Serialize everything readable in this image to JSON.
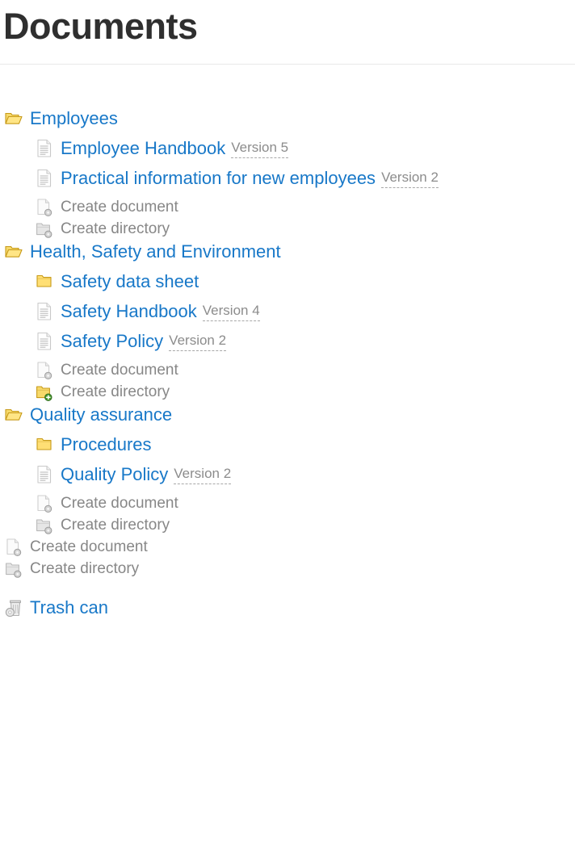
{
  "header": {
    "title": "Documents"
  },
  "colors": {
    "link": "#1878c8",
    "muted_text": "#878787",
    "version_text": "#8c8c8c",
    "heading": "#2f2f2f",
    "rule": "#e8e8e8",
    "folder_fill": "#ffe07a",
    "folder_border": "#c79a19",
    "badge_green": "#4a9b2f",
    "badge_gray": "#8e8e8e"
  },
  "tree": [
    {
      "id": "employees",
      "label": "Employees",
      "icon": "folder-open-icon",
      "type": "folder",
      "level": 0,
      "version": ""
    },
    {
      "id": "employee-handbook",
      "label": "Employee Handbook",
      "icon": "document-icon",
      "type": "document",
      "level": 1,
      "version": "Version 5"
    },
    {
      "id": "practical-information-for-new-employees",
      "label": "Practical information for new employees",
      "icon": "document-icon",
      "type": "document",
      "level": 1,
      "version": "Version 2"
    },
    {
      "id": "create-document-employees",
      "label": "Create document",
      "icon": "create-document-icon",
      "type": "action",
      "level": 1,
      "version": ""
    },
    {
      "id": "create-directory-employees",
      "label": "Create directory",
      "icon": "create-directory-icon",
      "type": "action",
      "level": 1,
      "version": ""
    },
    {
      "id": "health-safety-and-environment",
      "label": "Health, Safety and Environment",
      "icon": "folder-open-icon",
      "type": "folder",
      "level": 0,
      "version": ""
    },
    {
      "id": "safety-data-sheet",
      "label": "Safety data sheet",
      "icon": "folder-closed-icon",
      "type": "folder",
      "level": 1,
      "version": ""
    },
    {
      "id": "safety-handbook",
      "label": "Safety Handbook",
      "icon": "document-icon",
      "type": "document",
      "level": 1,
      "version": "Version 4"
    },
    {
      "id": "safety-policy",
      "label": "Safety Policy",
      "icon": "document-icon",
      "type": "document",
      "level": 1,
      "version": "Version 2"
    },
    {
      "id": "create-document-hse",
      "label": "Create document",
      "icon": "create-document-icon",
      "type": "action",
      "level": 1,
      "version": ""
    },
    {
      "id": "create-directory-hse",
      "label": "Create directory",
      "icon": "create-directory-active-icon",
      "type": "action",
      "level": 1,
      "version": ""
    },
    {
      "id": "quality-assurance",
      "label": "Quality assurance",
      "icon": "folder-open-icon",
      "type": "folder",
      "level": 0,
      "version": ""
    },
    {
      "id": "procedures",
      "label": "Procedures",
      "icon": "folder-closed-icon",
      "type": "folder",
      "level": 1,
      "version": ""
    },
    {
      "id": "quality-policy",
      "label": "Quality Policy",
      "icon": "document-icon",
      "type": "document",
      "level": 1,
      "version": "Version 2"
    },
    {
      "id": "create-document-qa",
      "label": "Create document",
      "icon": "create-document-icon",
      "type": "action",
      "level": 1,
      "version": ""
    },
    {
      "id": "create-directory-qa",
      "label": "Create directory",
      "icon": "create-directory-icon",
      "type": "action",
      "level": 1,
      "version": ""
    },
    {
      "id": "create-document-root",
      "label": "Create document",
      "icon": "create-document-icon",
      "type": "action",
      "level": 0,
      "version": ""
    },
    {
      "id": "create-directory-root",
      "label": "Create directory",
      "icon": "create-directory-icon",
      "type": "action",
      "level": 0,
      "version": ""
    },
    {
      "id": "trash-can",
      "label": "Trash can",
      "icon": "trash-can-icon",
      "type": "trash",
      "level": 0,
      "version": ""
    }
  ]
}
